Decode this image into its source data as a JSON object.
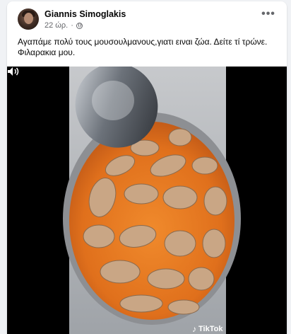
{
  "post": {
    "author": "Giannis Simoglakis",
    "time": "22 ώρ.",
    "separator": "·",
    "privacy_icon": "globe-icon",
    "menu_icon": "more-options-icon",
    "menu_label": "•••",
    "caption": "Αγαπάμε πολύ τους μουσουλμανους,γιατι ειναι ζώα. Δείτε τί τρώνε. Φιλαρακια μου."
  },
  "video": {
    "watermark": "TikTok",
    "watermark_icon": "tiktok-logo-icon",
    "controls_icon": "volume-icon"
  },
  "colors": {
    "page_background": "#f0f2f5",
    "card_background": "#ffffff",
    "text_primary": "#050505",
    "text_secondary": "#65676b",
    "video_background": "#000000"
  }
}
